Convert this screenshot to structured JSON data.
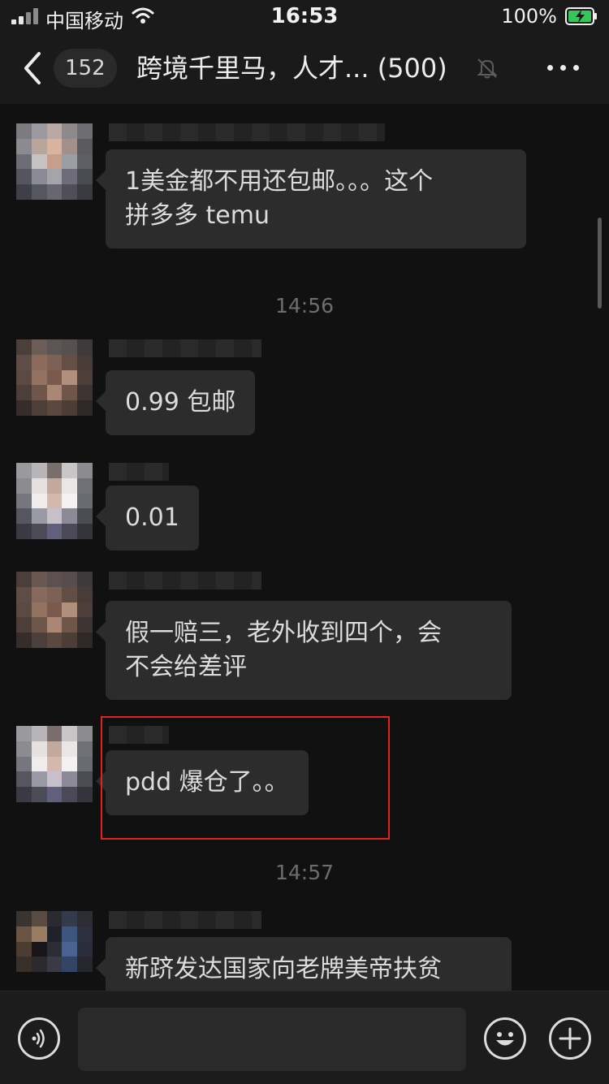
{
  "status_bar": {
    "carrier": "中国移动",
    "time": "16:53",
    "battery_percent": "100%"
  },
  "nav": {
    "unread_count": "152",
    "title": "跨境千里马，人才... (500)",
    "icons": [
      "back-arrow-icon",
      "mute-bell-icon",
      "more-dots-icon"
    ]
  },
  "messages": [
    {
      "text": "1美金都不用还包邮。。。这个拼多多temu",
      "line1": "1美金都不用还包邮。。。这个",
      "line2": "拼多多 temu"
    },
    {
      "timestamp": "14:56"
    },
    {
      "text": "0.99 包邮"
    },
    {
      "text": "0.01"
    },
    {
      "text": "假一赔三，老外收到四个，会不会给差评",
      "line1": "假一赔三，老外收到四个，会",
      "line2": "不会给差评"
    },
    {
      "text": "pdd 爆仓了。。",
      "highlighted": true
    },
    {
      "timestamp": "14:57"
    },
    {
      "text": "新跻发达国家向老牌美帝扶贫",
      "line1": "新跻发达国家向老牌美帝扶贫"
    }
  ],
  "input_bar": {
    "icons": [
      "voice-icon",
      "emoji-icon",
      "plus-icon"
    ]
  },
  "colors": {
    "background": "#111111",
    "bubble": "#2c2c2c",
    "highlight_border": "#e0241b"
  }
}
